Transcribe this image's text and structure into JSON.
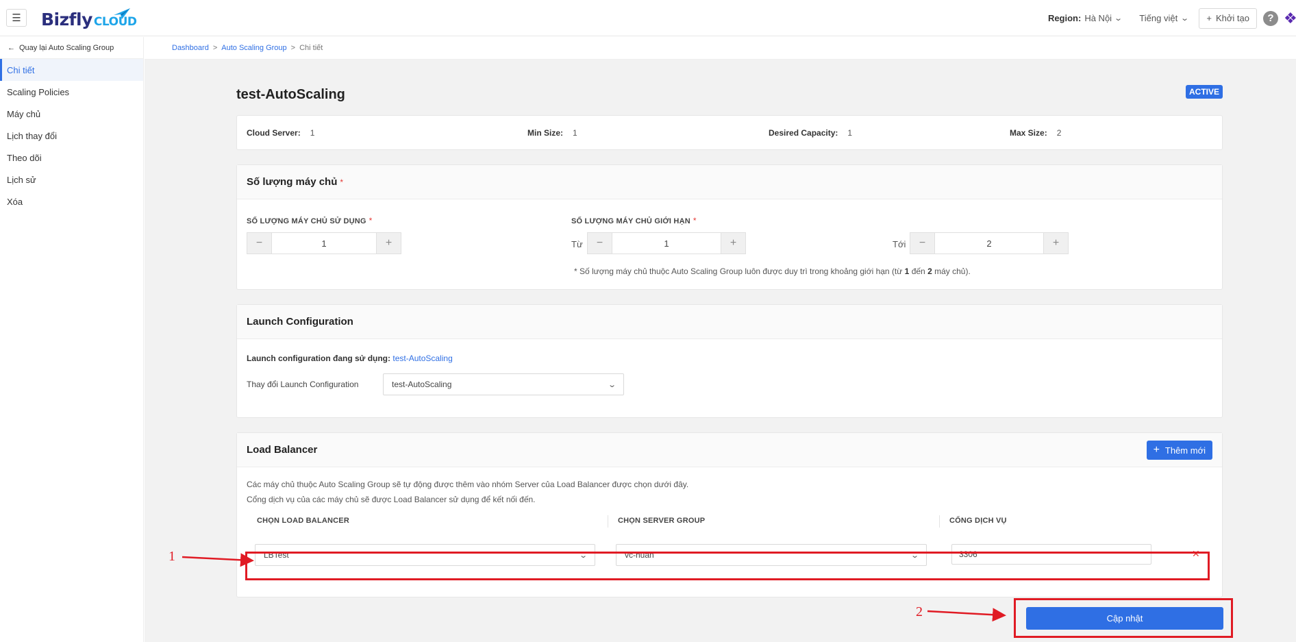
{
  "header": {
    "logo_main": "Bizfly",
    "logo_sub": "CLOUD",
    "region_label": "Region:",
    "region_value": "Hà Nội",
    "language": "Tiếng việt",
    "create_label": "Khởi tạo",
    "help_glyph": "?"
  },
  "sidebar": {
    "back_label": "Quay lại Auto Scaling Group",
    "items": [
      {
        "label": "Chi tiết"
      },
      {
        "label": "Scaling Policies"
      },
      {
        "label": "Máy chủ"
      },
      {
        "label": "Lịch thay đổi"
      },
      {
        "label": "Theo dõi"
      },
      {
        "label": "Lịch sử"
      },
      {
        "label": "Xóa"
      }
    ]
  },
  "breadcrumb": {
    "items": [
      "Dashboard",
      "Auto Scaling Group",
      "Chi tiết"
    ],
    "separator": ">"
  },
  "page": {
    "title": "test-AutoScaling",
    "status": "ACTIVE"
  },
  "stats": {
    "cloud_server_label": "Cloud Server:",
    "cloud_server_value": "1",
    "min_size_label": "Min Size:",
    "min_size_value": "1",
    "desired_label": "Desired Capacity:",
    "desired_value": "1",
    "max_size_label": "Max Size:",
    "max_size_value": "2"
  },
  "quantity": {
    "title": "Số lượng máy chủ",
    "required_mark": "*",
    "used_label": "SỐ LƯỢNG MÁY CHỦ SỬ DỤNG",
    "used_value": "1",
    "limit_label": "SỐ LƯỢNG MÁY CHỦ GIỚI HẠN",
    "from_label": "Từ",
    "from_value": "1",
    "to_label": "Tới",
    "to_value": "2",
    "minus": "−",
    "plus": "+",
    "note_prefix": "* Số lượng máy chủ thuộc Auto Scaling Group luôn được duy trì trong khoảng giới hạn (từ",
    "note_from": "1",
    "note_mid": "đến",
    "note_to": "2",
    "note_suffix": "máy chủ)."
  },
  "launch_config": {
    "title": "Launch Configuration",
    "current_label": "Launch configuration đang sử dụng:",
    "current_value": "test-AutoScaling",
    "change_label": "Thay đổi Launch Configuration",
    "selected": "test-AutoScaling"
  },
  "load_balancer": {
    "title": "Load Balancer",
    "add_label": "Thêm mới",
    "desc_1": "Các máy chủ thuộc Auto Scaling Group sẽ tự động được thêm vào nhóm Server của Load Balancer được chọn dưới đây.",
    "desc_2": "Cổng dịch vụ của các máy chủ sẽ được Load Balancer sử dụng để kết nối đến.",
    "col_lb": "CHỌN LOAD BALANCER",
    "col_sg": "CHỌN SERVER GROUP",
    "col_port": "CỔNG DỊCH VỤ",
    "row": {
      "lb": "LBTest",
      "server_group": "vc-huan",
      "port": "3306"
    }
  },
  "footer": {
    "update_label": "Cập nhật"
  },
  "annotations": {
    "label_1": "1",
    "label_2": "2",
    "color": "#e01b24"
  },
  "colors": {
    "accent": "#2f6fe4",
    "brand": "#2b2f7d",
    "required": "#e53935"
  }
}
